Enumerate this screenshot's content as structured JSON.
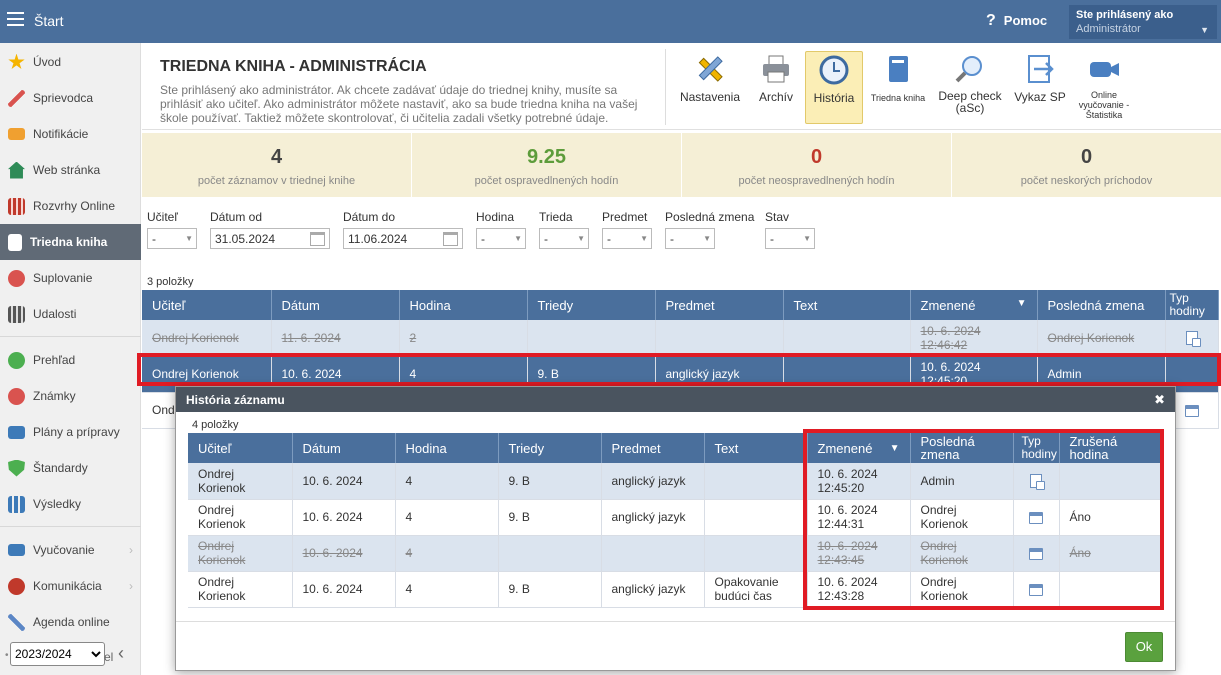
{
  "app": {
    "start_label": "Štart",
    "help_label": "Pomoc",
    "help_glyph": "?",
    "user_line1": "Ste prihlásený ako",
    "user_line2": "Administrátor",
    "accent": "#4a6f9c",
    "highlight": "#e01b24"
  },
  "sidebar": {
    "items": [
      {
        "label": "Úvod",
        "icon": "star-icon",
        "color": "#f5b400"
      },
      {
        "label": "Sprievodca",
        "icon": "wand-icon",
        "color": "#d9534f"
      },
      {
        "label": "Notifikácie",
        "icon": "envelope-icon",
        "color": "#f0a030"
      },
      {
        "label": "Web stránka",
        "icon": "house-icon",
        "color": "#2e8b57"
      },
      {
        "label": "Rozvrhy Online",
        "icon": "grid-icon",
        "color": "#c0392b"
      },
      {
        "label": "Triedna kniha",
        "icon": "book-icon",
        "color": "#ffffff"
      },
      {
        "label": "Suplovanie",
        "icon": "person-icon",
        "color": "#d9534f"
      },
      {
        "label": "Udalosti",
        "icon": "calendar-icon",
        "color": "#555555"
      },
      {
        "label": "Prehľad",
        "icon": "check-circle-icon",
        "color": "#4caf50"
      },
      {
        "label": "Známky",
        "icon": "grade-icon",
        "color": "#d9534f"
      },
      {
        "label": "Plány a prípravy",
        "icon": "briefcase-icon",
        "color": "#3d7ab8"
      },
      {
        "label": "Štandardy",
        "icon": "shield-check-icon",
        "color": "#4caf50"
      },
      {
        "label": "Výsledky",
        "icon": "bar-chart-icon",
        "color": "#3d7ab8"
      },
      {
        "label": "Vyučovanie",
        "icon": "open-book-icon",
        "color": "#3d7ab8"
      },
      {
        "label": "Komunikácia",
        "icon": "chat-icon",
        "color": "#c0392b"
      },
      {
        "label": "Agenda online",
        "icon": "pencil-icon",
        "color": "#5b86c5"
      }
    ],
    "year": "2023/2024",
    "year_options": [
      "2023/2024"
    ],
    "trailing_fragment": "el",
    "collapse_glyph": "‹"
  },
  "header": {
    "title": "TRIEDNA KNIHA - ADMINISTRÁCIA",
    "description": "Ste prihlásený ako administrátor. Ak chcete zadávať údaje do triednej knihy, musíte sa prihlásiť ako učiteľ. Ako administrátor môžete nastaviť, ako sa bude triedna kniha na vašej škole používať. Taktiež môžete skontrolovať, či učitelia zadali všetky potrebné údaje."
  },
  "toolbar": {
    "settings": "Nastavenia",
    "archive": "Archív",
    "history": "História",
    "class_book": "Triedna kniha",
    "deep_check": "Deep check (aSc)",
    "report_sp": "Vykaz SP",
    "online_stats": "Online vyučovanie - Štatistika"
  },
  "stats": [
    {
      "value": "4",
      "label": "počet záznamov v triednej knihe",
      "color": "normal"
    },
    {
      "value": "9.25",
      "label": "počet ospravedlnených hodín",
      "color": "green"
    },
    {
      "value": "0",
      "label": "počet neospravedlnených hodín",
      "color": "red"
    },
    {
      "value": "0",
      "label": "počet neskorých príchodov",
      "color": "normal"
    }
  ],
  "filters": {
    "teacher_label": "Učiteľ",
    "teacher_value": "-",
    "date_from_label": "Dátum od",
    "date_from_value": "31.05.2024",
    "date_to_label": "Dátum do",
    "date_to_value": "11.06.2024",
    "hour_label": "Hodina",
    "hour_value": "-",
    "class_label": "Trieda",
    "class_value": "-",
    "subject_label": "Predmet",
    "subject_value": "-",
    "last_change_label": "Posledná zmena",
    "last_change_value": "-",
    "state_label": "Stav",
    "state_value": "-"
  },
  "main_table": {
    "count": "3 položky",
    "headers": [
      "Učiteľ",
      "Dátum",
      "Hodina",
      "Triedy",
      "Predmet",
      "Text",
      "Zmenené",
      "Posledná zmena",
      "Typ hodiny"
    ],
    "sort_glyph": "▼",
    "rows": [
      {
        "teacher": "Ondrej Korienok",
        "date": "11. 6. 2024",
        "hour": "2",
        "class": "",
        "subject": "",
        "text": "",
        "changed": "10. 6. 2024 12:46:42",
        "last": "Ondrej Korienok"
      },
      {
        "teacher": "Ondrej Korienok",
        "date": "10. 6. 2024",
        "hour": "4",
        "class": "9. B",
        "subject": "anglický jazyk",
        "text": "",
        "changed": "10. 6. 2024 12:45:20",
        "last": "Admin"
      },
      {
        "teacher": "Ond"
      }
    ]
  },
  "modal": {
    "title": "História záznamu",
    "close_glyph": "✖",
    "count": "4 položky",
    "headers": [
      "Učiteľ",
      "Dátum",
      "Hodina",
      "Triedy",
      "Predmet",
      "Text",
      "Zmenené",
      "Posledná zmena",
      "Typ hodiny",
      "Zrušená hodina"
    ],
    "rows": [
      {
        "teacher": "Ondrej Korienok",
        "date": "10. 6. 2024",
        "hour": "4",
        "class": "9. B",
        "subject": "anglický jazyk",
        "text": "",
        "changed": "10. 6. 2024 12:45:20",
        "last": "Admin",
        "cancelled": ""
      },
      {
        "teacher": "Ondrej Korienok",
        "date": "10. 6. 2024",
        "hour": "4",
        "class": "9. B",
        "subject": "anglický jazyk",
        "text": "",
        "changed": "10. 6. 2024 12:44:31",
        "last": "Ondrej Korienok",
        "cancelled": "Áno"
      },
      {
        "teacher": "Ondrej Korienok",
        "date": "10. 6. 2024",
        "hour": "4",
        "class": "",
        "subject": "",
        "text": "",
        "changed": "10. 6. 2024 12:43:45",
        "last": "Ondrej Korienok",
        "cancelled": "Áno"
      },
      {
        "teacher": "Ondrej Korienok",
        "date": "10. 6. 2024",
        "hour": "4",
        "class": "9. B",
        "subject": "anglický jazyk",
        "text": "Opakovanie budúci čas",
        "changed": "10. 6. 2024 12:43:28",
        "last": "Ondrej Korienok",
        "cancelled": ""
      }
    ],
    "ok_label": "Ok"
  }
}
